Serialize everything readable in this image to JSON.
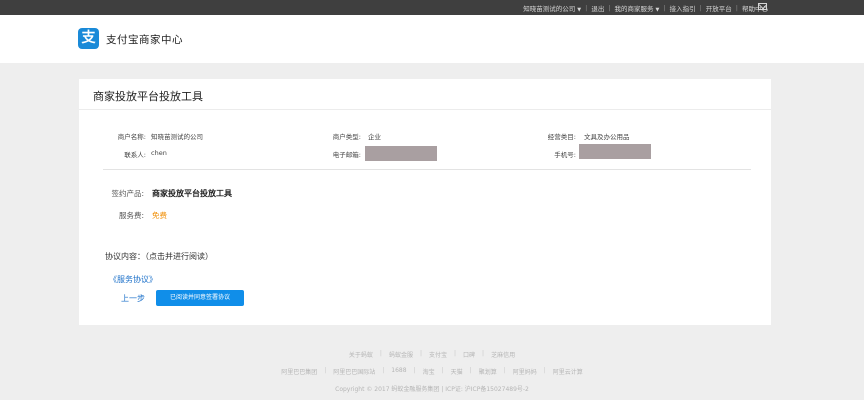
{
  "topbar": {
    "company": "知晓苗测试的公司",
    "logout": "退出",
    "merchant_service": "我的商家服务",
    "guide": "接入指引",
    "open_platform": "开放平台",
    "help": "帮助中心"
  },
  "header": {
    "logo_char": "支",
    "title": "支付宝商家中心"
  },
  "card": {
    "title": "商家投放平台投放工具",
    "merchant_name_label": "商户名称:",
    "merchant_name": "知晓苗测试的公司",
    "merchant_type_label": "商户类型:",
    "merchant_type": "企业",
    "category_label": "经营类目:",
    "category": "文具及办公用品",
    "contact_label": "联系人:",
    "contact": "chen",
    "email_label": "电子邮箱:",
    "phone_label": "手机号:",
    "product_label": "签约产品:",
    "product": "商家投放平台投放工具",
    "fee_label": "服务费:",
    "fee": "免费",
    "agreement_label": "协议内容：（点击并进行阅读）",
    "agreement_link": "《服务协议》",
    "prev_step": "上一步",
    "agree_button": "已阅读并同意签署协议"
  },
  "footer": {
    "row1": [
      "关于蚂蚁",
      "蚂蚁金服",
      "支付宝",
      "口碑",
      "芝麻信用"
    ],
    "row2": [
      "阿里巴巴集团",
      "阿里巴巴国际站",
      "1688",
      "淘宝",
      "天猫",
      "聚划算",
      "阿里妈妈",
      "阿里云计算"
    ],
    "copyright": "Copyright © 2017 蚂蚁金融服务集团 | ICP证: 沪ICP备15027489号-2"
  }
}
